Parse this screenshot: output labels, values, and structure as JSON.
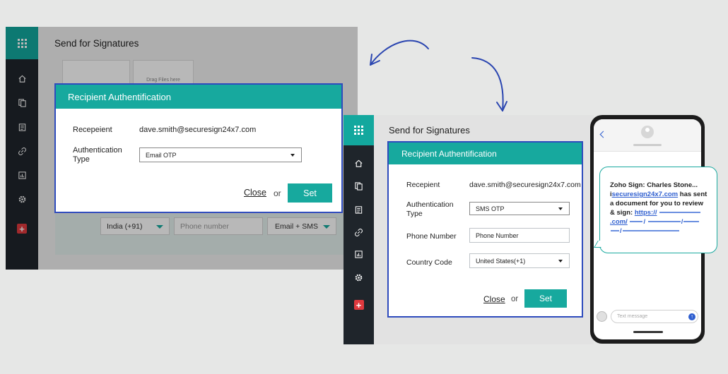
{
  "app_name": "Send for Signatures",
  "modal_title": "Recipient Authentification",
  "left_window": {
    "recipient_label": "Recepeient",
    "recipient_value": "dave.smith@securesign24x7.com",
    "auth_label_line1": "Authentication",
    "auth_label_line2": "Type",
    "auth_value": "Email OTP",
    "close_label": "Close",
    "or_label": "or",
    "set_label": "Set",
    "background": {
      "drag_text": "Drag Files here",
      "country_select": "India (+91)",
      "phone_placeholder": "Phone number",
      "delivery_select": "Email + SMS"
    }
  },
  "right_window": {
    "recipient_label": "Recepient",
    "recipient_value": "dave.smith@securesign24x7.com",
    "auth_label_line1": "Authentication",
    "auth_label_line2": "Type",
    "auth_value": "SMS OTP",
    "phone_label": "Phone Number",
    "phone_value": "Phone Number",
    "country_label": "Country Code",
    "country_value": "United States(+1)",
    "close_label": "Close",
    "or_label": "or",
    "set_label": "Set"
  },
  "phone": {
    "sms_line1": "Zoho Sign: Charles Stone...",
    "sms_prefix": "i",
    "sms_link_domain": "securesign24x7.com",
    "sms_line2_rest": " has sent",
    "sms_line3": "a document for you to review",
    "sms_line4_prefix": "& sign: ",
    "sms_url_start": "https://",
    "sms_url_com": ".com/",
    "text_placeholder": "Text message",
    "back_icon": "chevron-left-icon",
    "send_icon": "send-arrow-icon"
  },
  "colors": {
    "accent": "#17a99e",
    "modal_border": "#2e4bbd",
    "sidebar": "#1f252b",
    "add_button": "#e0393e",
    "arrow": "#2a45b0"
  }
}
